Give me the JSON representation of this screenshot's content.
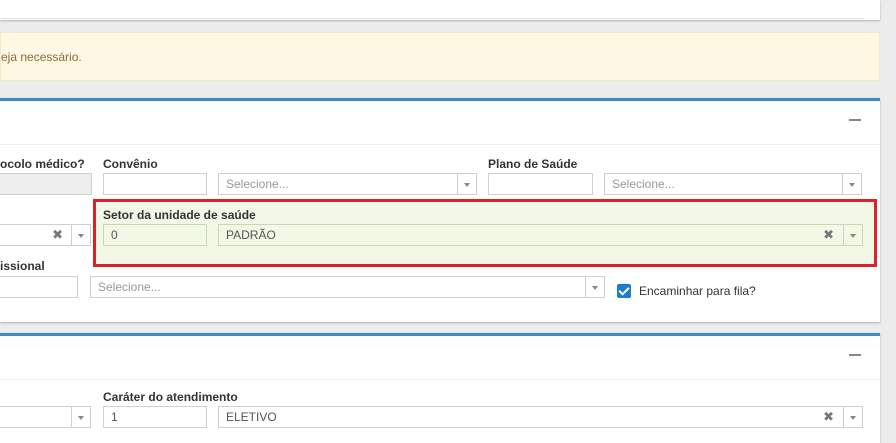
{
  "alert": {
    "text": "eja necessário."
  },
  "form1": {
    "protocolo_label": "ocolo médico?",
    "convenio": {
      "label": "Convênio",
      "code_value": "",
      "select_placeholder": "Selecione..."
    },
    "plano": {
      "label": "Plano de Saúde",
      "code_value": "",
      "select_placeholder": "Selecione..."
    },
    "setor": {
      "label": "Setor da unidade de saúde",
      "code_value": "0",
      "select_value": "PADRÃO"
    },
    "profissional": {
      "label": "issional",
      "select_placeholder": "Selecione..."
    },
    "encaminhar": {
      "label": "Encaminhar para fila?",
      "checked": true
    }
  },
  "form2": {
    "carater": {
      "label": "Caráter do atendimento",
      "code_value": "1",
      "select_value": "ELETIVO"
    }
  },
  "icons": {
    "clear": "✖",
    "collapse": "minus-icon",
    "dropdown": "chevron-down-icon"
  },
  "colors": {
    "box_accent": "#3c8dbc",
    "highlight_border": "#d9232a",
    "highlight_bg": "#f1f8e5",
    "alert_bg": "#fdf7e3",
    "checkbox": "#1f7ad1"
  }
}
